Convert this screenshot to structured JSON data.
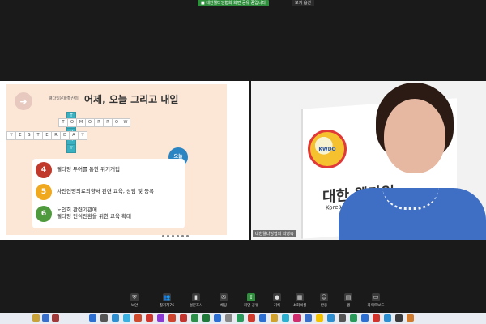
{
  "top": {
    "share_banner": "■ 대한웰다잉협회 화면 공유 중입니다",
    "view_button": "보기 옵션"
  },
  "slide": {
    "kicker": "웰다잉문화확산의",
    "title": "어제, 오늘 그리고 내일",
    "tomorrow_letters": [
      "T",
      "O",
      "M",
      "O",
      "R",
      "R",
      "O",
      "W"
    ],
    "yesterday_letters": [
      "Y",
      "E",
      "S",
      "T",
      "E",
      "R",
      "D",
      "A",
      "Y"
    ],
    "today_letters": [
      "T",
      "O",
      "D",
      "A",
      "Y"
    ],
    "today_badge": "오늘",
    "items": [
      {
        "num": "4",
        "text": "웰다잉 투어를 통한 위기개입",
        "color": "#c0392b"
      },
      {
        "num": "5",
        "text": "사전연명의료의향서 관련 교육, 상담 및 등록",
        "color": "#f0a81e"
      },
      {
        "num": "6",
        "text_line1": "노인회 관련기관에",
        "text_line2": "웰다잉 인식전환을 위한 교육 확대",
        "color": "#4f9a3c"
      }
    ]
  },
  "video": {
    "wall_text_ko": "대한 웰다잉",
    "wall_text_en": "Korean Well-Dying Org",
    "logo_text": "KWDO",
    "name_tag": "대한웰다잉협회 최영숙"
  },
  "controls": [
    {
      "label": "보안",
      "icon": "shield-icon"
    },
    {
      "label": "참가자",
      "icon": "participants-icon"
    },
    {
      "label": "설문조사",
      "icon": "poll-icon"
    },
    {
      "label": "채팅",
      "icon": "chat-icon"
    },
    {
      "label": "화면 공유",
      "icon": "share-screen-icon"
    },
    {
      "label": "기록",
      "icon": "record-icon"
    },
    {
      "label": "소회의실",
      "icon": "breakout-icon"
    },
    {
      "label": "반응",
      "icon": "reaction-icon"
    },
    {
      "label": "앱",
      "icon": "apps-icon"
    },
    {
      "label": "화이트보드",
      "icon": "whiteboard-icon"
    }
  ],
  "participants_count": "76",
  "colors": {
    "share_green": "#2f8f3d",
    "slide_bg": "#fce6d6",
    "today_blue": "#2b85c2"
  }
}
